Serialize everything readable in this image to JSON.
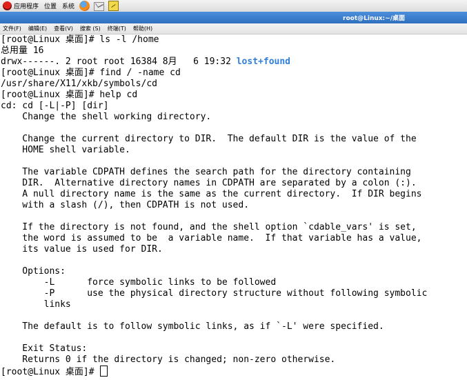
{
  "top_panel": {
    "menus": [
      "应用程序",
      "位置",
      "系统"
    ],
    "launchers": [
      "firefox-icon",
      "mail-icon",
      "notes-icon"
    ]
  },
  "window": {
    "title": "root@Linux:~/桌面"
  },
  "menu_bar": {
    "items": [
      "文件(F)",
      "编辑(E)",
      "查看(V)",
      "搜索 (S)",
      "终端(T)",
      "帮助(H)"
    ]
  },
  "terminal": {
    "lines": [
      "[root@Linux 桌面]# ls -l /home",
      "总用量 16",
      "drwx------. 2 root root 16384 8月   6 19:32 ",
      "[root@Linux 桌面]# find / -name cd",
      "/usr/share/X11/xkb/symbols/cd",
      "[root@Linux 桌面]# help cd",
      "cd: cd [-L|-P] [dir]",
      "    Change the shell working directory.",
      "",
      "    Change the current directory to DIR.  The default DIR is the value of the",
      "    HOME shell variable.",
      "",
      "    The variable CDPATH defines the search path for the directory containing",
      "    DIR.  Alternative directory names in CDPATH are separated by a colon (:).",
      "    A null directory name is the same as the current directory.  If DIR begins",
      "    with a slash (/), then CDPATH is not used.",
      "",
      "    If the directory is not found, and the shell option `cdable_vars' is set,",
      "    the word is assumed to be  a variable name.  If that variable has a value,",
      "    its value is used for DIR.",
      "",
      "    Options:",
      "        -L      force symbolic links to be followed",
      "        -P      use the physical directory structure without following symbolic",
      "        links",
      "",
      "    The default is to follow symbolic links, as if `-L' were specified.",
      "",
      "    Exit Status:",
      "    Returns 0 if the directory is changed; non-zero otherwise.",
      "[root@Linux 桌面]# "
    ],
    "dir_entry": "lost+found",
    "dir_color": "#2f7fd8"
  }
}
